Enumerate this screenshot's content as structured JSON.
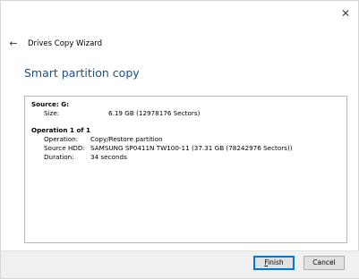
{
  "window": {
    "close_glyph": "✕"
  },
  "header": {
    "back_glyph": "←",
    "title": "Drives Copy Wizard"
  },
  "page": {
    "heading": "Smart partition copy"
  },
  "summary": {
    "source": {
      "title": "Source: G:",
      "size_label": "Size:",
      "size_value": "6.19 GB (12978176 Sectors)"
    },
    "operation": {
      "title": "Operation 1 of 1",
      "operation_label": "Operation:",
      "operation_value": "Copy/Restore partition",
      "source_hdd_label": "Source HDD:",
      "source_hdd_value": "SAMSUNG SP0411N TW100-11 (37.31 GB (78242976 Sectors))",
      "duration_label": "Duration:",
      "duration_value": "34 seconds"
    }
  },
  "footer": {
    "finish_label_first": "F",
    "finish_label_rest": "inish",
    "cancel_label": "Cancel"
  },
  "colors": {
    "heading": "#1a4f86",
    "default_button_border": "#0078d7",
    "footer_bg": "#f0f0f0"
  }
}
